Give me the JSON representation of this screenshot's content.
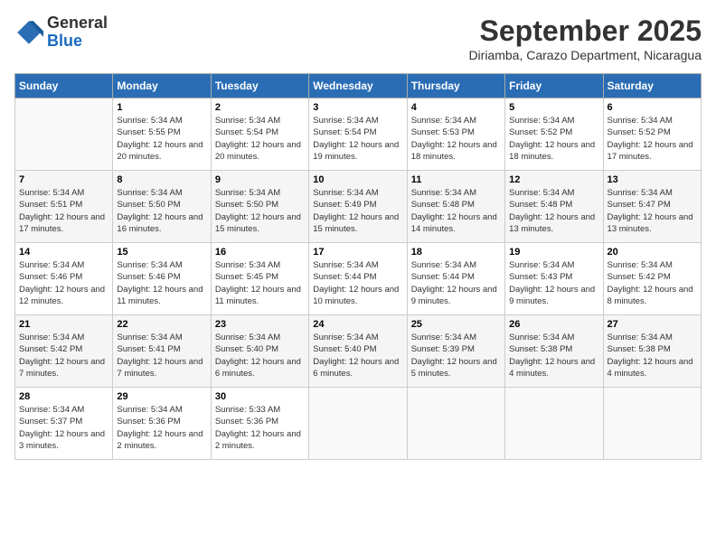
{
  "header": {
    "logo": {
      "general": "General",
      "blue": "Blue"
    },
    "title": "September 2025",
    "subtitle": "Diriamba, Carazo Department, Nicaragua"
  },
  "calendar": {
    "days_of_week": [
      "Sunday",
      "Monday",
      "Tuesday",
      "Wednesday",
      "Thursday",
      "Friday",
      "Saturday"
    ],
    "weeks": [
      [
        {
          "day": "",
          "sunrise": "",
          "sunset": "",
          "daylight": ""
        },
        {
          "day": "1",
          "sunrise": "Sunrise: 5:34 AM",
          "sunset": "Sunset: 5:55 PM",
          "daylight": "Daylight: 12 hours and 20 minutes."
        },
        {
          "day": "2",
          "sunrise": "Sunrise: 5:34 AM",
          "sunset": "Sunset: 5:54 PM",
          "daylight": "Daylight: 12 hours and 20 minutes."
        },
        {
          "day": "3",
          "sunrise": "Sunrise: 5:34 AM",
          "sunset": "Sunset: 5:54 PM",
          "daylight": "Daylight: 12 hours and 19 minutes."
        },
        {
          "day": "4",
          "sunrise": "Sunrise: 5:34 AM",
          "sunset": "Sunset: 5:53 PM",
          "daylight": "Daylight: 12 hours and 18 minutes."
        },
        {
          "day": "5",
          "sunrise": "Sunrise: 5:34 AM",
          "sunset": "Sunset: 5:52 PM",
          "daylight": "Daylight: 12 hours and 18 minutes."
        },
        {
          "day": "6",
          "sunrise": "Sunrise: 5:34 AM",
          "sunset": "Sunset: 5:52 PM",
          "daylight": "Daylight: 12 hours and 17 minutes."
        }
      ],
      [
        {
          "day": "7",
          "sunrise": "Sunrise: 5:34 AM",
          "sunset": "Sunset: 5:51 PM",
          "daylight": "Daylight: 12 hours and 17 minutes."
        },
        {
          "day": "8",
          "sunrise": "Sunrise: 5:34 AM",
          "sunset": "Sunset: 5:50 PM",
          "daylight": "Daylight: 12 hours and 16 minutes."
        },
        {
          "day": "9",
          "sunrise": "Sunrise: 5:34 AM",
          "sunset": "Sunset: 5:50 PM",
          "daylight": "Daylight: 12 hours and 15 minutes."
        },
        {
          "day": "10",
          "sunrise": "Sunrise: 5:34 AM",
          "sunset": "Sunset: 5:49 PM",
          "daylight": "Daylight: 12 hours and 15 minutes."
        },
        {
          "day": "11",
          "sunrise": "Sunrise: 5:34 AM",
          "sunset": "Sunset: 5:48 PM",
          "daylight": "Daylight: 12 hours and 14 minutes."
        },
        {
          "day": "12",
          "sunrise": "Sunrise: 5:34 AM",
          "sunset": "Sunset: 5:48 PM",
          "daylight": "Daylight: 12 hours and 13 minutes."
        },
        {
          "day": "13",
          "sunrise": "Sunrise: 5:34 AM",
          "sunset": "Sunset: 5:47 PM",
          "daylight": "Daylight: 12 hours and 13 minutes."
        }
      ],
      [
        {
          "day": "14",
          "sunrise": "Sunrise: 5:34 AM",
          "sunset": "Sunset: 5:46 PM",
          "daylight": "Daylight: 12 hours and 12 minutes."
        },
        {
          "day": "15",
          "sunrise": "Sunrise: 5:34 AM",
          "sunset": "Sunset: 5:46 PM",
          "daylight": "Daylight: 12 hours and 11 minutes."
        },
        {
          "day": "16",
          "sunrise": "Sunrise: 5:34 AM",
          "sunset": "Sunset: 5:45 PM",
          "daylight": "Daylight: 12 hours and 11 minutes."
        },
        {
          "day": "17",
          "sunrise": "Sunrise: 5:34 AM",
          "sunset": "Sunset: 5:44 PM",
          "daylight": "Daylight: 12 hours and 10 minutes."
        },
        {
          "day": "18",
          "sunrise": "Sunrise: 5:34 AM",
          "sunset": "Sunset: 5:44 PM",
          "daylight": "Daylight: 12 hours and 9 minutes."
        },
        {
          "day": "19",
          "sunrise": "Sunrise: 5:34 AM",
          "sunset": "Sunset: 5:43 PM",
          "daylight": "Daylight: 12 hours and 9 minutes."
        },
        {
          "day": "20",
          "sunrise": "Sunrise: 5:34 AM",
          "sunset": "Sunset: 5:42 PM",
          "daylight": "Daylight: 12 hours and 8 minutes."
        }
      ],
      [
        {
          "day": "21",
          "sunrise": "Sunrise: 5:34 AM",
          "sunset": "Sunset: 5:42 PM",
          "daylight": "Daylight: 12 hours and 7 minutes."
        },
        {
          "day": "22",
          "sunrise": "Sunrise: 5:34 AM",
          "sunset": "Sunset: 5:41 PM",
          "daylight": "Daylight: 12 hours and 7 minutes."
        },
        {
          "day": "23",
          "sunrise": "Sunrise: 5:34 AM",
          "sunset": "Sunset: 5:40 PM",
          "daylight": "Daylight: 12 hours and 6 minutes."
        },
        {
          "day": "24",
          "sunrise": "Sunrise: 5:34 AM",
          "sunset": "Sunset: 5:40 PM",
          "daylight": "Daylight: 12 hours and 6 minutes."
        },
        {
          "day": "25",
          "sunrise": "Sunrise: 5:34 AM",
          "sunset": "Sunset: 5:39 PM",
          "daylight": "Daylight: 12 hours and 5 minutes."
        },
        {
          "day": "26",
          "sunrise": "Sunrise: 5:34 AM",
          "sunset": "Sunset: 5:38 PM",
          "daylight": "Daylight: 12 hours and 4 minutes."
        },
        {
          "day": "27",
          "sunrise": "Sunrise: 5:34 AM",
          "sunset": "Sunset: 5:38 PM",
          "daylight": "Daylight: 12 hours and 4 minutes."
        }
      ],
      [
        {
          "day": "28",
          "sunrise": "Sunrise: 5:34 AM",
          "sunset": "Sunset: 5:37 PM",
          "daylight": "Daylight: 12 hours and 3 minutes."
        },
        {
          "day": "29",
          "sunrise": "Sunrise: 5:34 AM",
          "sunset": "Sunset: 5:36 PM",
          "daylight": "Daylight: 12 hours and 2 minutes."
        },
        {
          "day": "30",
          "sunrise": "Sunrise: 5:33 AM",
          "sunset": "Sunset: 5:36 PM",
          "daylight": "Daylight: 12 hours and 2 minutes."
        },
        {
          "day": "",
          "sunrise": "",
          "sunset": "",
          "daylight": ""
        },
        {
          "day": "",
          "sunrise": "",
          "sunset": "",
          "daylight": ""
        },
        {
          "day": "",
          "sunrise": "",
          "sunset": "",
          "daylight": ""
        },
        {
          "day": "",
          "sunrise": "",
          "sunset": "",
          "daylight": ""
        }
      ]
    ]
  }
}
